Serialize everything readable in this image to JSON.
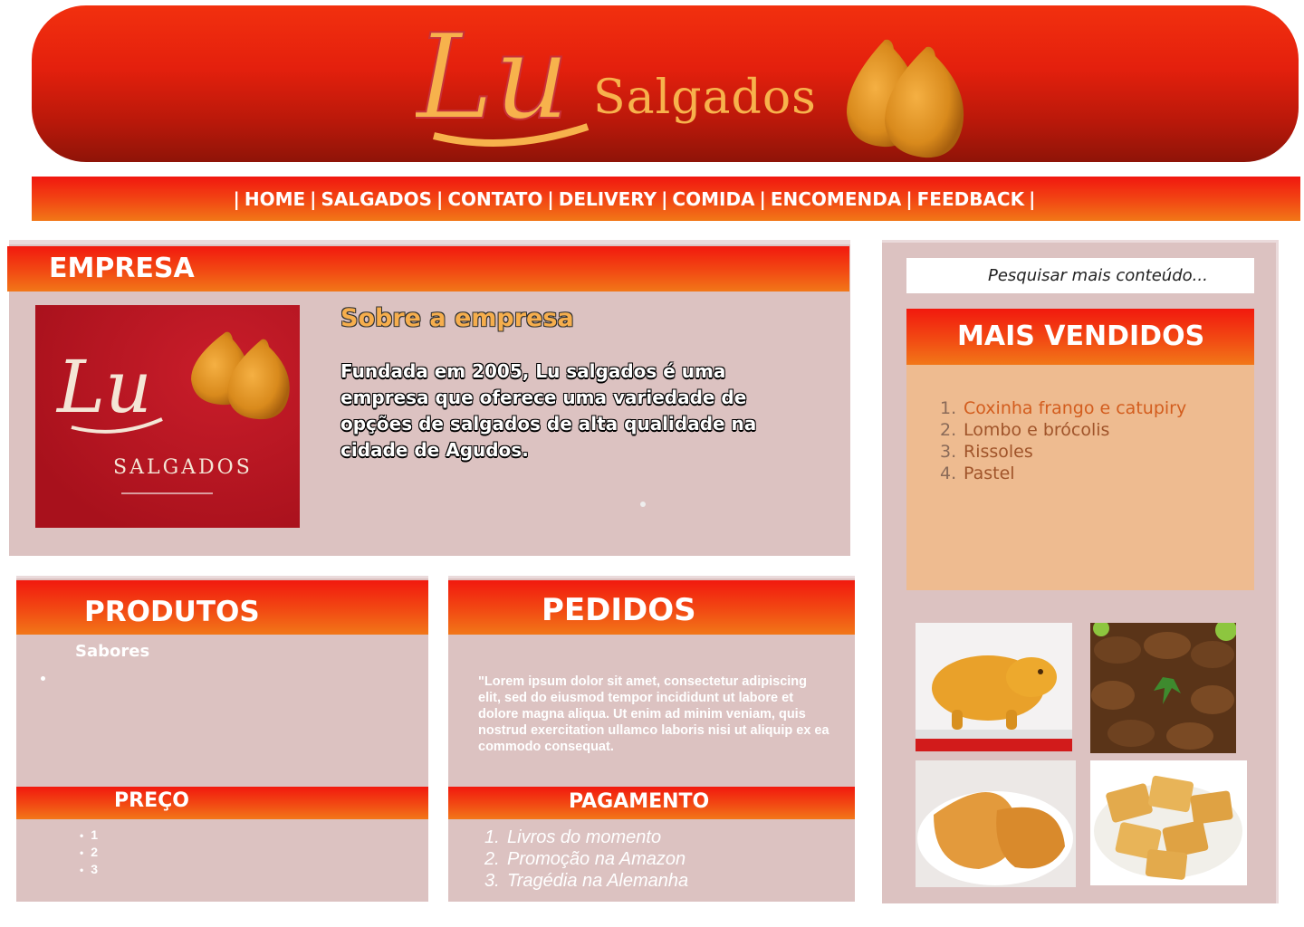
{
  "header": {
    "logo_script": "Lu",
    "logo_word": "Salgados"
  },
  "nav": {
    "items": [
      "HOME",
      "SALGADOS",
      "CONTATO",
      "DELIVERY",
      "COMIDA",
      "ENCOMENDA",
      "FEEDBACK"
    ],
    "separator": "|"
  },
  "empresa": {
    "title": "EMPRESA",
    "logo_script": "Lu",
    "logo_word": "SALGADOS",
    "sobre_title": "Sobre a empresa",
    "sobre_text": "Fundada em 2005,  Lu salgados é uma empresa  que oferece uma variedade de opções de salgados de alta qualidade na cidade de Agudos."
  },
  "produtos": {
    "title": "PRODUTOS",
    "sabores_label": "Sabores",
    "preco_title": "PREÇO",
    "preco_items": [
      "1",
      "2",
      "3"
    ]
  },
  "pedidos": {
    "title": "PEDIDOS",
    "text": "\"Lorem ipsum dolor sit amet, consectetur adipiscing elit, sed do eiusmod tempor incididunt ut labore et dolore magna aliqua. Ut enim ad minim veniam, quis nostrud exercitation ullamco laboris nisi ut aliquip ex ea commodo consequat.",
    "pagamento_title": "PAGAMENTO",
    "pagamento_items": [
      "Livros do momento",
      "Promoção na Amazon",
      "Tragédia na Alemanha"
    ]
  },
  "sidebar": {
    "search_placeholder": "Pesquisar mais conteúdo...",
    "mais_vendidos_title": "MAIS VENDIDOS",
    "mais_vendidos": [
      "Coxinha frango e catupiry",
      "Lombo e brócolis",
      "Rissoles",
      "Pastel"
    ]
  },
  "colors": {
    "header_red": "#e4200d",
    "nav_gradient_top": "#f1170f",
    "nav_gradient_bottom": "#f27717",
    "panel_bg": "#dcc2c1",
    "mais_vendidos_bg": "#eebb90",
    "logo_gold": "#f7b24c"
  }
}
